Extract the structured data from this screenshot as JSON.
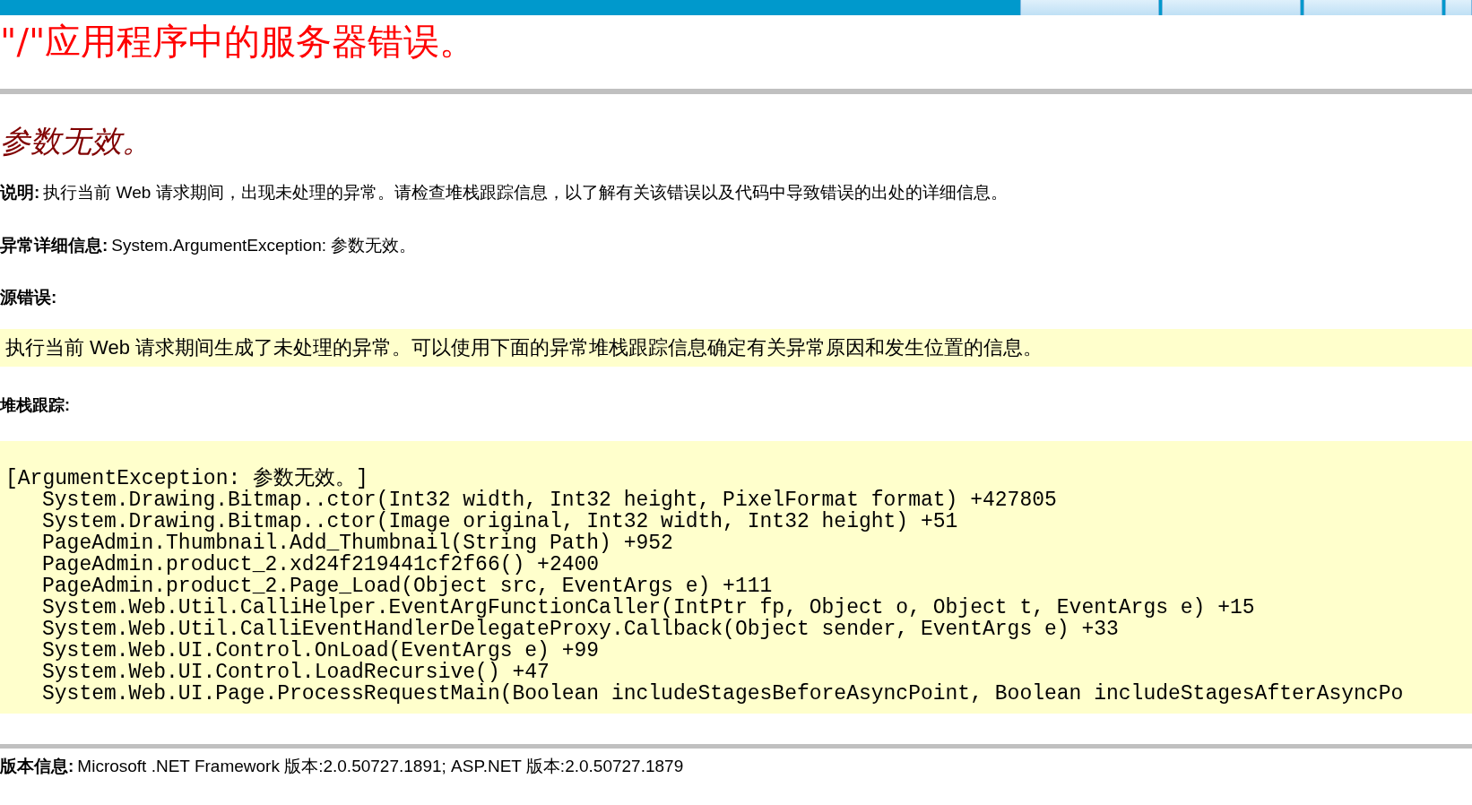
{
  "top_bar": {
    "tabs": [
      {
        "selected": false
      },
      {
        "selected": false
      },
      {
        "selected": false
      },
      {
        "selected": false
      }
    ]
  },
  "title": "\"/\"应用程序中的服务器错误。",
  "error_heading": "参数无效。",
  "description": {
    "label": "说明:",
    "text": "执行当前 Web 请求期间，出现未处理的异常。请检查堆栈跟踪信息，以了解有关该错误以及代码中导致错误的出处的详细信息。"
  },
  "exception_details": {
    "label": "异常详细信息:",
    "text": "System.ArgumentException: 参数无效。"
  },
  "source_error": {
    "label": "源错误:",
    "box_text": "执行当前 Web 请求期间生成了未处理的异常。可以使用下面的异常堆栈跟踪信息确定有关异常原因和发生位置的信息。"
  },
  "stack_trace": {
    "label": "堆栈跟踪:",
    "header": "[ArgumentException: 参数无效。]",
    "lines": [
      "System.Drawing.Bitmap..ctor(Int32 width, Int32 height, PixelFormat format) +427805",
      "System.Drawing.Bitmap..ctor(Image original, Int32 width, Int32 height) +51",
      "PageAdmin.Thumbnail.Add_Thumbnail(String Path) +952",
      "PageAdmin.product_2.xd24f219441cf2f66() +2400",
      "PageAdmin.product_2.Page_Load(Object src, EventArgs e) +111",
      "System.Web.Util.CalliHelper.EventArgFunctionCaller(IntPtr fp, Object o, Object t, EventArgs e) +15",
      "System.Web.Util.CalliEventHandlerDelegateProxy.Callback(Object sender, EventArgs e) +33",
      "System.Web.UI.Control.OnLoad(EventArgs e) +99",
      "System.Web.UI.Control.LoadRecursive() +47",
      "System.Web.UI.Page.ProcessRequestMain(Boolean includeStagesBeforeAsyncPoint, Boolean includeStagesAfterAsyncPo"
    ]
  },
  "version": {
    "label": "版本信息:",
    "text": "Microsoft .NET Framework 版本:2.0.50727.1891; ASP.NET 版本:2.0.50727.1879"
  }
}
